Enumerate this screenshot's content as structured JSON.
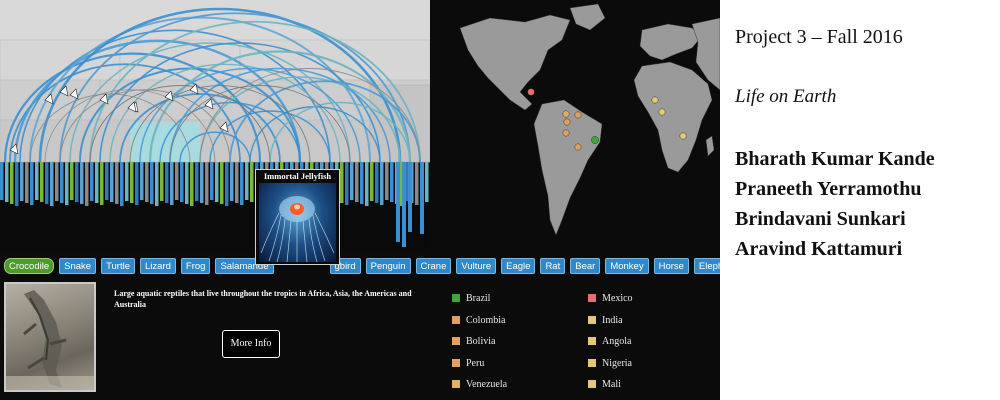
{
  "animals": [
    "Crocodile",
    "Snake",
    "Turtle",
    "Lizard",
    "Frog",
    "Salamander",
    "Hummingbird",
    "Penguin",
    "Crane",
    "Vulture",
    "Eagle",
    "Rat",
    "Bear",
    "Monkey",
    "Horse",
    "Elephant"
  ],
  "tab_labels_shown": [
    "Crocodile",
    "Snake",
    "Turtle",
    "Lizard",
    "Frog",
    "Salamande",
    "",
    "gbird",
    "Penguin",
    "Crane",
    "Vulture",
    "Eagle",
    "Rat",
    "Bear",
    "Monkey",
    "Horse",
    "Elepha"
  ],
  "selected_animal": "Crocodile",
  "tooltip": {
    "title": "Immortal Jellyfish"
  },
  "description": "Large aquatic reptiles that live throughout the tropics in Africa, Asia, the Americas and Australia",
  "more_info_label": "More Info",
  "countries": [
    {
      "name": "Brazil",
      "color": "#3ea83a"
    },
    {
      "name": "Colombia",
      "color": "#e0a060"
    },
    {
      "name": "Bolivia",
      "color": "#e0a060"
    },
    {
      "name": "Peru",
      "color": "#e0a060"
    },
    {
      "name": "Venezuela",
      "color": "#e0b060"
    },
    {
      "name": "Mexico",
      "color": "#e07070"
    },
    {
      "name": "India",
      "color": "#e6c778"
    },
    {
      "name": "Angola",
      "color": "#e6c778"
    },
    {
      "name": "Nigeria",
      "color": "#e6c778"
    },
    {
      "name": "Mali",
      "color": "#e6c778"
    }
  ],
  "project": {
    "title": "Project 3 – Fall 2016",
    "subtitle": "Life on Earth",
    "authors": [
      "Bharath Kumar Kande",
      "Praneeth Yerramothu",
      "Brindavani Sunkari",
      "Aravind Kattamuri"
    ]
  },
  "colors": {
    "tab_blue": "#2f88c9",
    "tab_active": "#4f9a2c",
    "arc_blue": "#3a8fd0",
    "arc_teal": "#6bb4c0"
  }
}
